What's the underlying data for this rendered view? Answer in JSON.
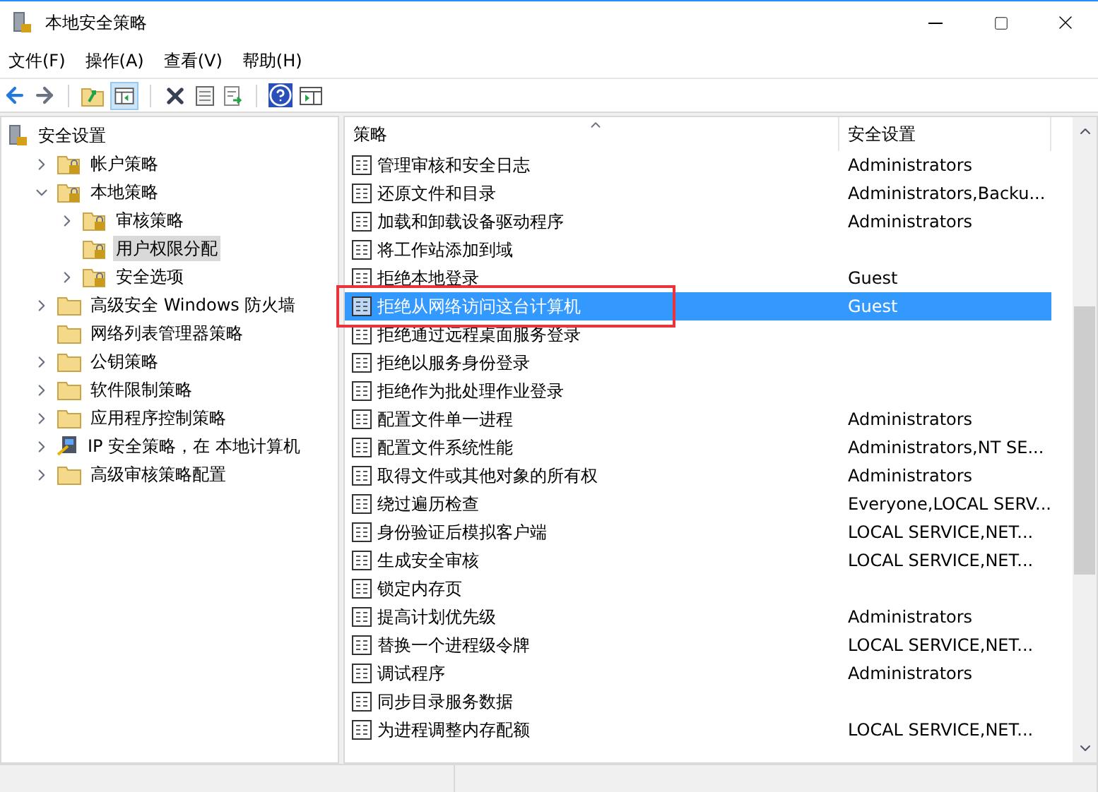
{
  "window": {
    "title": "本地安全策略"
  },
  "menu": [
    "文件(F)",
    "操作(A)",
    "查看(V)",
    "帮助(H)"
  ],
  "tree": {
    "label": "安全设置",
    "kind": "computer",
    "selected": false,
    "children": [
      {
        "label": "帐户策略",
        "kind": "lock-folder",
        "expanded": false,
        "selected": false
      },
      {
        "label": "本地策略",
        "kind": "lock-folder",
        "expanded": true,
        "selected": false,
        "children": [
          {
            "label": "审核策略",
            "kind": "lock-folder",
            "expanded": false,
            "selected": false
          },
          {
            "label": "用户权限分配",
            "kind": "lock-folder",
            "selected": true
          },
          {
            "label": "安全选项",
            "kind": "lock-folder",
            "expanded": false,
            "selected": false
          }
        ]
      },
      {
        "label": "高级安全 Windows 防火墙",
        "kind": "folder",
        "expanded": false,
        "selected": false
      },
      {
        "label": "网络列表管理器策略",
        "kind": "folder",
        "selected": false
      },
      {
        "label": "公钥策略",
        "kind": "folder",
        "expanded": false,
        "selected": false
      },
      {
        "label": "软件限制策略",
        "kind": "folder",
        "expanded": false,
        "selected": false
      },
      {
        "label": "应用程序控制策略",
        "kind": "folder",
        "expanded": false,
        "selected": false
      },
      {
        "label": "IP 安全策略，在 本地计算机",
        "kind": "network",
        "expanded": false,
        "selected": false
      },
      {
        "label": "高级审核策略配置",
        "kind": "folder",
        "expanded": false,
        "selected": false
      }
    ]
  },
  "table": {
    "columns": [
      "策略",
      "安全设置"
    ],
    "rows": [
      {
        "policy": "管理审核和安全日志",
        "setting": "Administrators",
        "selected": false
      },
      {
        "policy": "还原文件和目录",
        "setting": "Administrators,Backu...",
        "selected": false
      },
      {
        "policy": "加载和卸载设备驱动程序",
        "setting": "Administrators",
        "selected": false
      },
      {
        "policy": "将工作站添加到域",
        "selected": false
      },
      {
        "policy": "拒绝本地登录",
        "setting": "Guest",
        "selected": false
      },
      {
        "policy": "拒绝从网络访问这台计算机",
        "setting": "Guest",
        "selected": true,
        "highlighted": true
      },
      {
        "policy": "拒绝通过远程桌面服务登录",
        "selected": false
      },
      {
        "policy": "拒绝以服务身份登录",
        "selected": false
      },
      {
        "policy": "拒绝作为批处理作业登录",
        "selected": false
      },
      {
        "policy": "配置文件单一进程",
        "setting": "Administrators",
        "selected": false
      },
      {
        "policy": "配置文件系统性能",
        "setting": "Administrators,NT SE...",
        "selected": false
      },
      {
        "policy": "取得文件或其他对象的所有权",
        "setting": "Administrators",
        "selected": false
      },
      {
        "policy": "绕过遍历检查",
        "setting": "Everyone,LOCAL SERV...",
        "selected": false
      },
      {
        "policy": "身份验证后模拟客户端",
        "setting": "LOCAL SERVICE,NET...",
        "selected": false
      },
      {
        "policy": "生成安全审核",
        "setting": "LOCAL SERVICE,NET...",
        "selected": false
      },
      {
        "policy": "锁定内存页",
        "selected": false
      },
      {
        "policy": "提高计划优先级",
        "setting": "Administrators",
        "selected": false
      },
      {
        "policy": "替换一个进程级令牌",
        "setting": "LOCAL SERVICE,NET...",
        "selected": false
      },
      {
        "policy": "调试程序",
        "setting": "Administrators",
        "selected": false
      },
      {
        "policy": "同步目录服务数据",
        "selected": false
      },
      {
        "policy": "为进程调整内存配额",
        "setting": "LOCAL SERVICE,NET...",
        "selected": false
      }
    ]
  }
}
